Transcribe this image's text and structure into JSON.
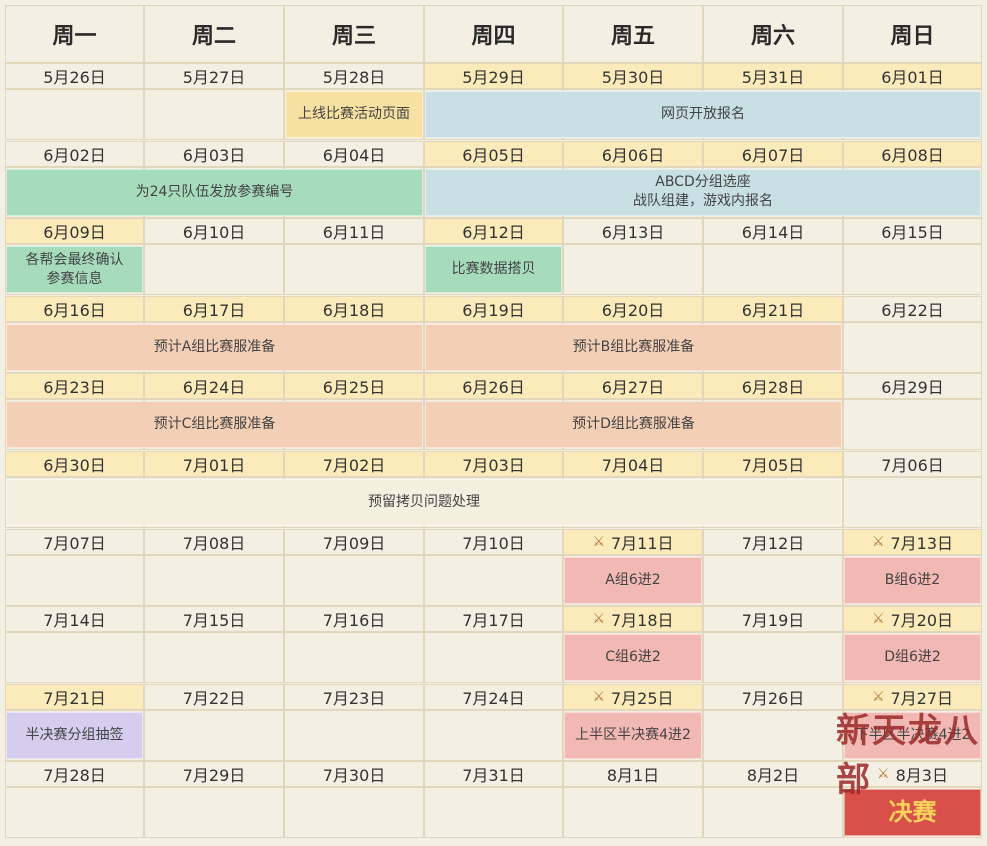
{
  "weekdays": [
    "周一",
    "周二",
    "周三",
    "周四",
    "周五",
    "周六",
    "周日"
  ],
  "weeks": [
    {
      "dates": [
        "5月26日",
        "5月27日",
        "5月28日",
        "5月29日",
        "5月30日",
        "5月31日",
        "6月01日"
      ],
      "hl": [
        false,
        false,
        false,
        true,
        true,
        true,
        true
      ],
      "swords": []
    },
    {
      "dates": [
        "6月02日",
        "6月03日",
        "6月04日",
        "6月05日",
        "6月06日",
        "6月07日",
        "6月08日"
      ],
      "hl": [
        false,
        false,
        false,
        true,
        true,
        true,
        true
      ],
      "swords": []
    },
    {
      "dates": [
        "6月09日",
        "6月10日",
        "6月11日",
        "6月12日",
        "6月13日",
        "6月14日",
        "6月15日"
      ],
      "hl": [
        true,
        false,
        false,
        true,
        false,
        false,
        false
      ],
      "swords": []
    },
    {
      "dates": [
        "6月16日",
        "6月17日",
        "6月18日",
        "6月19日",
        "6月20日",
        "6月21日",
        "6月22日"
      ],
      "hl": [
        true,
        true,
        true,
        true,
        true,
        true,
        false
      ],
      "swords": []
    },
    {
      "dates": [
        "6月23日",
        "6月24日",
        "6月25日",
        "6月26日",
        "6月27日",
        "6月28日",
        "6月29日"
      ],
      "hl": [
        true,
        true,
        true,
        true,
        true,
        true,
        false
      ],
      "swords": []
    },
    {
      "dates": [
        "6月30日",
        "7月01日",
        "7月02日",
        "7月03日",
        "7月04日",
        "7月05日",
        "7月06日"
      ],
      "hl": [
        true,
        true,
        true,
        true,
        true,
        true,
        false
      ],
      "swords": []
    },
    {
      "dates": [
        "7月07日",
        "7月08日",
        "7月09日",
        "7月10日",
        "7月11日",
        "7月12日",
        "7月13日"
      ],
      "hl": [
        false,
        false,
        false,
        false,
        true,
        false,
        true
      ],
      "swords": [
        4,
        6
      ]
    },
    {
      "dates": [
        "7月14日",
        "7月15日",
        "7月16日",
        "7月17日",
        "7月18日",
        "7月19日",
        "7月20日"
      ],
      "hl": [
        false,
        false,
        false,
        false,
        true,
        false,
        true
      ],
      "swords": [
        4,
        6
      ]
    },
    {
      "dates": [
        "7月21日",
        "7月22日",
        "7月23日",
        "7月24日",
        "7月25日",
        "7月26日",
        "7月27日"
      ],
      "hl": [
        true,
        false,
        false,
        false,
        true,
        false,
        true
      ],
      "swords": [
        4,
        6
      ]
    },
    {
      "dates": [
        "7月28日",
        "7月29日",
        "7月30日",
        "7月31日",
        "8月1日",
        "8月2日",
        "8月3日"
      ],
      "hl": [
        false,
        false,
        false,
        false,
        false,
        false,
        false
      ],
      "swords": [
        6
      ]
    }
  ],
  "events": [
    {
      "week": 0,
      "col": 2,
      "span": 1,
      "text": "上线比赛活动页面",
      "color": "#f7e1a2"
    },
    {
      "week": 0,
      "col": 3,
      "span": 4,
      "text": "网页开放报名",
      "color": "#c8dfe4"
    },
    {
      "week": 1,
      "col": 0,
      "span": 3,
      "text": "为24只队伍发放参赛编号",
      "color": "#a6dcbc"
    },
    {
      "week": 1,
      "col": 3,
      "span": 4,
      "text": "ABCD分组选座\n战队组建，游戏内报名",
      "color": "#c8dfe4"
    },
    {
      "week": 2,
      "col": 0,
      "span": 1,
      "text": "各帮会最终确认\n参赛信息",
      "color": "#a6dcbc"
    },
    {
      "week": 2,
      "col": 3,
      "span": 1,
      "text": "比赛数据搭贝",
      "color": "#a6dcbc"
    },
    {
      "week": 3,
      "col": 0,
      "span": 3,
      "text": "预计A组比赛服准备",
      "color": "#f3cfb6"
    },
    {
      "week": 3,
      "col": 3,
      "span": 3,
      "text": "预计B组比赛服准备",
      "color": "#f3cfb6"
    },
    {
      "week": 4,
      "col": 0,
      "span": 3,
      "text": "预计C组比赛服准备",
      "color": "#f3cfb6"
    },
    {
      "week": 4,
      "col": 3,
      "span": 3,
      "text": "预计D组比赛服准备",
      "color": "#f3cfb6"
    },
    {
      "week": 5,
      "col": 0,
      "span": 6,
      "text": "预留拷贝问题处理",
      "color": "#f5efe0"
    },
    {
      "week": 6,
      "col": 4,
      "span": 1,
      "text": "A组6进2",
      "color": "#f2b8b3"
    },
    {
      "week": 6,
      "col": 6,
      "span": 1,
      "text": "B组6进2",
      "color": "#f2b8b3"
    },
    {
      "week": 7,
      "col": 4,
      "span": 1,
      "text": "C组6进2",
      "color": "#f2b8b3"
    },
    {
      "week": 7,
      "col": 6,
      "span": 1,
      "text": "D组6进2",
      "color": "#f2b8b3"
    },
    {
      "week": 8,
      "col": 0,
      "span": 1,
      "text": "半决赛分组抽签",
      "color": "#d4cdee"
    },
    {
      "week": 8,
      "col": 4,
      "span": 1,
      "text": "上半区半决赛4进2",
      "color": "#f2b8b3"
    },
    {
      "week": 8,
      "col": 6,
      "span": 1,
      "text": "下半区半决赛4进2",
      "color": "#f2b8b3"
    },
    {
      "week": 9,
      "col": 6,
      "span": 1,
      "text": "决赛",
      "color": "#d9504a",
      "textColor": "#f7d35a",
      "fontSize": 24
    }
  ],
  "logo": {
    "text": "新天龙八部"
  },
  "colors": {
    "background": "#f4efe3",
    "highlight": "#fbeaba",
    "border": "#e2d6bd"
  }
}
